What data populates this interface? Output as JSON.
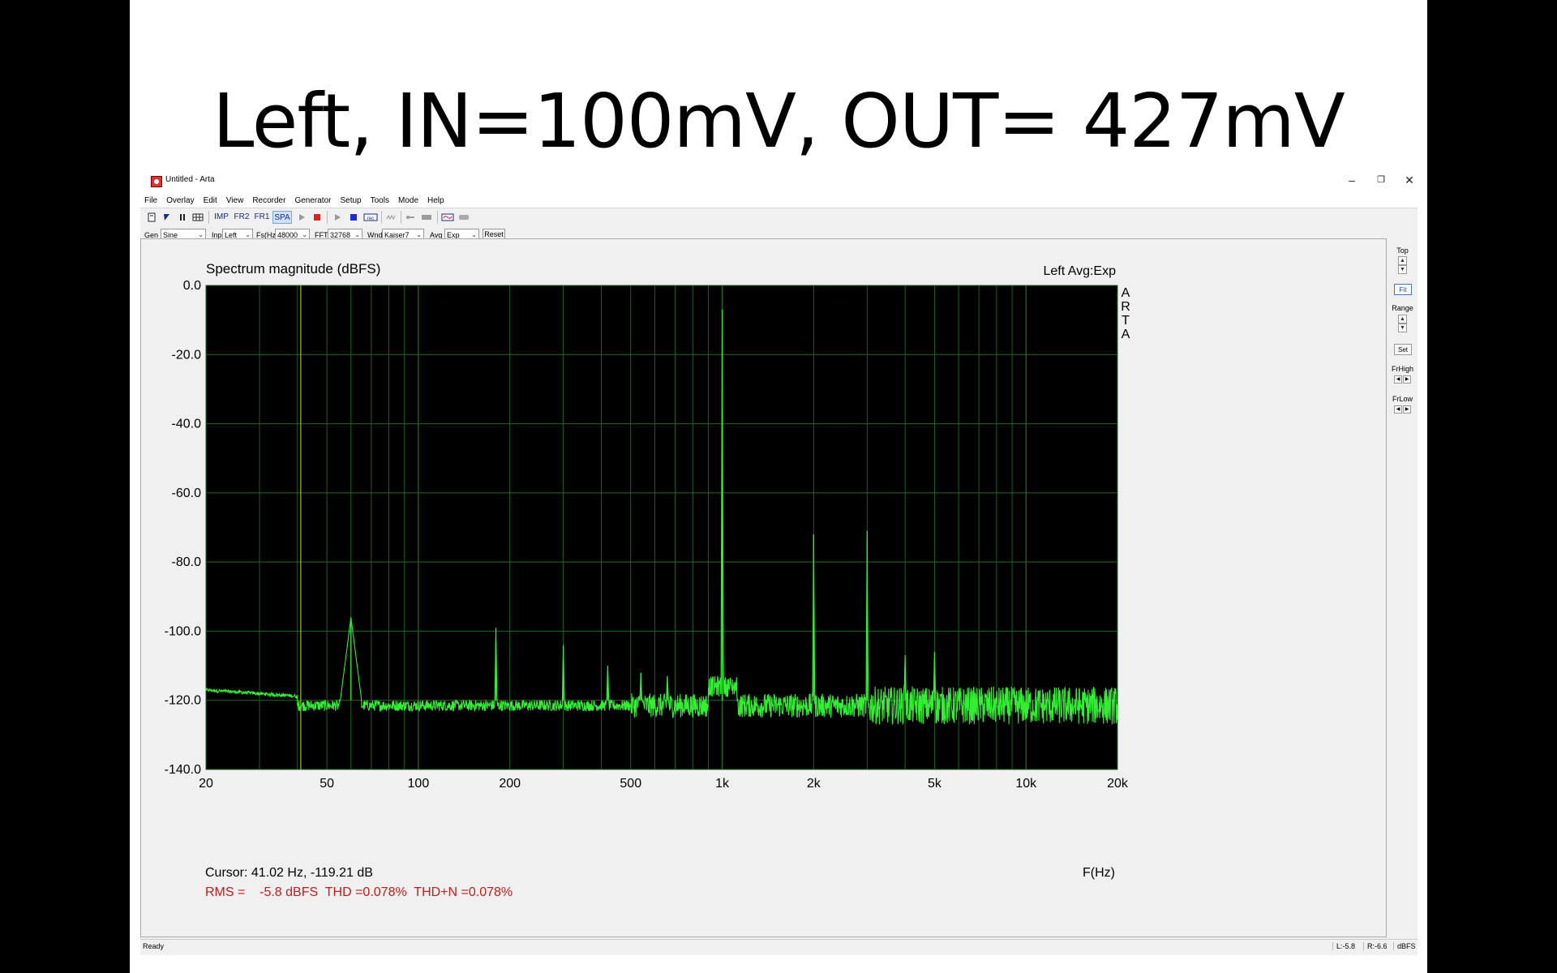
{
  "slide": {
    "title": "Left, IN=100mV, OUT= 427mV"
  },
  "window": {
    "title": "Untitled - Arta",
    "minimize": "–",
    "restore": "❐",
    "close": "✕"
  },
  "menu": [
    "File",
    "Overlay",
    "Edit",
    "View",
    "Recorder",
    "Generator",
    "Setup",
    "Tools",
    "Mode",
    "Help"
  ],
  "toolbar": {
    "imp": "IMP",
    "fr2": "FR2",
    "fr1": "FR1",
    "spa": "SPA"
  },
  "params": {
    "gen_label": "Gen",
    "gen_value": "Sine",
    "inp_label": "Inp",
    "inp_value": "Left",
    "fs_label": "Fs(Hz)",
    "fs_value": "48000",
    "fft_label": "FFT",
    "fft_value": "32768",
    "wnd_label": "Wnd",
    "wnd_value": "Kaiser7",
    "avg_label": "Avg",
    "avg_value": "Exp",
    "reset": "Reset"
  },
  "right_panel": {
    "top": "Top",
    "fit": "Fit",
    "range": "Range",
    "set": "Set",
    "frhigh": "FrHigh",
    "frlow": "FrLow"
  },
  "status": {
    "left": "Ready",
    "l_level": "L:-5.8",
    "r_level": "R:-6.6",
    "unit": "dBFS"
  },
  "chart_data": {
    "type": "line",
    "title": "Spectrum magnitude (dBFS)",
    "channel_info": "Left  Avg:Exp",
    "side_label": "ARTA",
    "xlabel": "F(Hz)",
    "xscale": "log",
    "xlim": [
      20,
      20000
    ],
    "ylim": [
      -140,
      0
    ],
    "y_ticks": [
      "0.0",
      "-20.0",
      "-40.0",
      "-60.0",
      "-80.0",
      "-100.0",
      "-120.0",
      "-140.0"
    ],
    "x_ticks": [
      "20",
      "50",
      "100",
      "200",
      "500",
      "1k",
      "2k",
      "5k",
      "10k",
      "20k"
    ],
    "grid": true,
    "background": "#000000",
    "trace_color": "#33ee33",
    "grid_color": "#1f6a1f",
    "cursor_line_hz": 41.02,
    "noise_floor_db": -120,
    "series": [
      {
        "peaks": [
          {
            "hz": 60,
            "db": -96
          },
          {
            "hz": 180,
            "db": -99
          },
          {
            "hz": 300,
            "db": -104
          },
          {
            "hz": 420,
            "db": -110
          },
          {
            "hz": 540,
            "db": -112
          },
          {
            "hz": 660,
            "db": -113
          },
          {
            "hz": 1000,
            "db": -7
          },
          {
            "hz": 2000,
            "db": -72
          },
          {
            "hz": 3000,
            "db": -71
          },
          {
            "hz": 4000,
            "db": -107
          },
          {
            "hz": 5000,
            "db": -106
          }
        ]
      }
    ],
    "cursor_readout": "Cursor: 41.02 Hz, -119.21 dB",
    "measurement": "RMS =    -5.8 dBFS  THD =0.078%  THD+N =0.078%"
  }
}
